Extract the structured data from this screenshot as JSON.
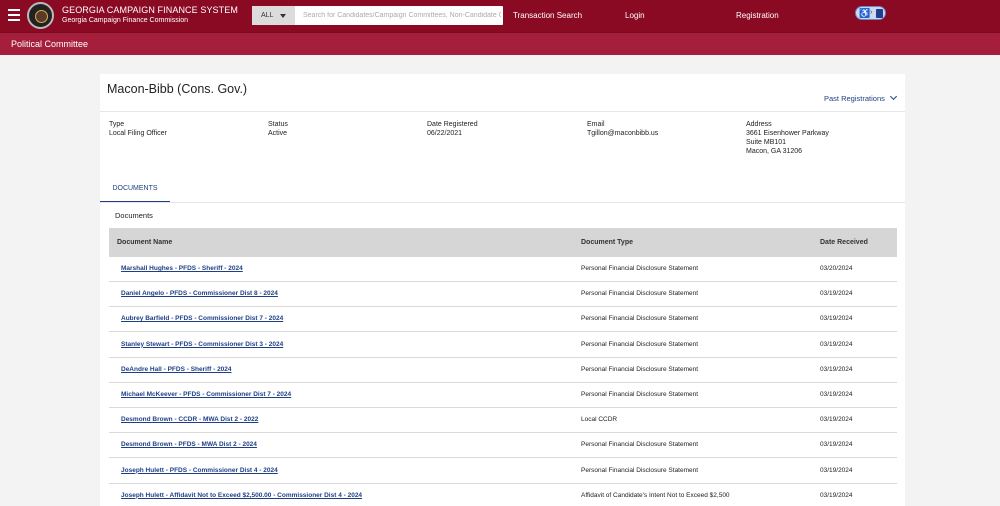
{
  "header": {
    "brand_title": "GEORGIA CAMPAIGN FINANCE SYSTEM",
    "brand_subtitle": "Georgia Campaign Finance Commission",
    "search_scope": "ALL",
    "search_placeholder": "Search for Candidates/Campaign Committees, Non-Candidate Committees...",
    "nav": {
      "transaction_search": "Transaction Search",
      "login": "Login",
      "registration": "Registration"
    }
  },
  "subheader": {
    "title": "Political Committee"
  },
  "entity": {
    "name": "Macon-Bibb (Cons. Gov.)",
    "past_registrations": "Past Registrations",
    "type_label": "Type",
    "type_value": "Local Filing Officer",
    "status_label": "Status",
    "status_value": "Active",
    "date_label": "Date Registered",
    "date_value": "06/22/2021",
    "email_label": "Email",
    "email_value": "Tgillon@maconbibb.us",
    "address_label": "Address",
    "address_line1": "3661 Eisenhower Parkway",
    "address_line2": "Suite MB101",
    "address_line3": "Macon, GA 31206"
  },
  "tabs": {
    "documents": "DOCUMENTS"
  },
  "documents": {
    "section_label": "Documents",
    "columns": {
      "name": "Document Name",
      "type": "Document Type",
      "date": "Date Received"
    },
    "rows": [
      {
        "name": "Marshall Hughes - PFDS - Sheriff - 2024",
        "type": "Personal Financial Disclosure Statement",
        "date": "03/20/2024"
      },
      {
        "name": "Daniel Angelo - PFDS - Commissioner Dist 8 - 2024",
        "type": "Personal Financial Disclosure Statement",
        "date": "03/19/2024"
      },
      {
        "name": "Aubrey Barfield - PFDS - Commissioner Dist 7 - 2024",
        "type": "Personal Financial Disclosure Statement",
        "date": "03/19/2024"
      },
      {
        "name": "Stanley Stewart - PFDS - Commissioner Dist 3 - 2024",
        "type": "Personal Financial Disclosure Statement",
        "date": "03/19/2024"
      },
      {
        "name": "DeAndre Hall - PFDS - Sheriff - 2024",
        "type": "Personal Financial Disclosure Statement",
        "date": "03/19/2024"
      },
      {
        "name": "Michael McKeever - PFDS - Commissioner Dist 7 - 2024",
        "type": "Personal Financial Disclosure Statement",
        "date": "03/19/2024"
      },
      {
        "name": "Desmond Brown - CCDR - MWA Dist 2 - 2022",
        "type": "Local CCDR",
        "date": "03/19/2024"
      },
      {
        "name": "Desmond Brown - PFDS - MWA Dist 2 - 2024",
        "type": "Personal Financial Disclosure Statement",
        "date": "03/19/2024"
      },
      {
        "name": "Joseph Hulett - PFDS - Commissioner Dist 4 - 2024",
        "type": "Personal Financial Disclosure Statement",
        "date": "03/19/2024"
      },
      {
        "name": "Joseph Hulett - Affidavit Not to Exceed $2,500.00 - Commissioner Dist 4 - 2024",
        "type": "Affidavit of Candidate's Intent Not to Exceed $2,500",
        "date": "03/19/2024"
      }
    ]
  }
}
